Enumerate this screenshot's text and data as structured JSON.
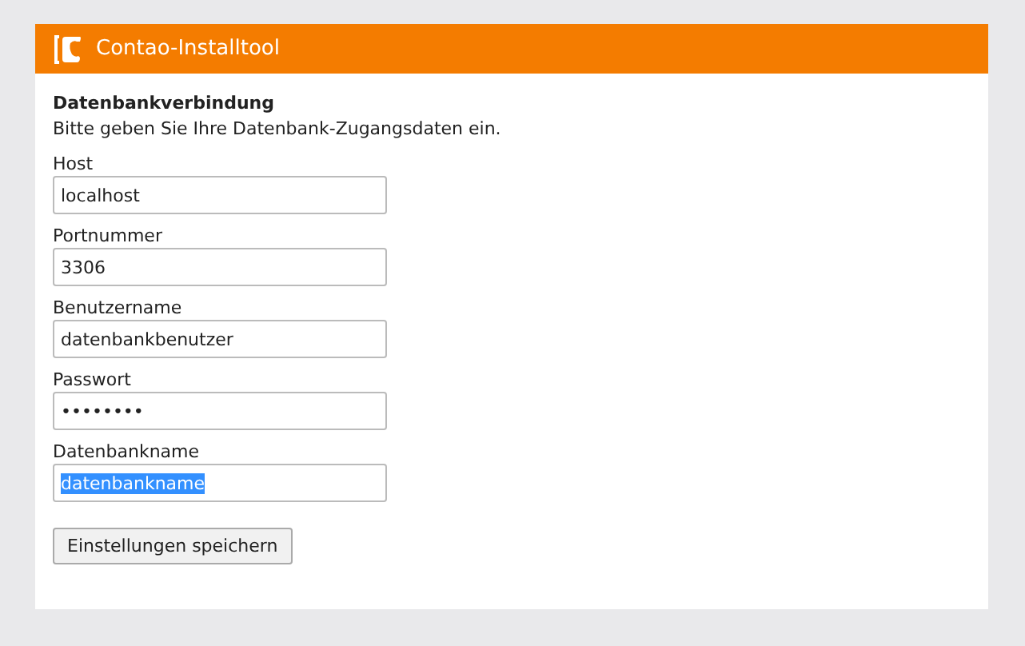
{
  "header": {
    "title": "Contao-Installtool"
  },
  "section": {
    "heading": "Datenbankverbindung",
    "description": "Bitte geben Sie Ihre Datenbank-Zugangsdaten ein."
  },
  "fields": [
    {
      "label": "Host",
      "value": "localhost",
      "selected": false
    },
    {
      "label": "Portnummer",
      "value": "3306",
      "selected": false
    },
    {
      "label": "Benutzername",
      "value": "datenbankbenutzer",
      "selected": false
    },
    {
      "label": "Passwort",
      "value": "••••••••",
      "selected": false
    },
    {
      "label": "Datenbankname",
      "value": "datenbankname",
      "selected": true
    }
  ],
  "button": "Einstellungen speichern"
}
